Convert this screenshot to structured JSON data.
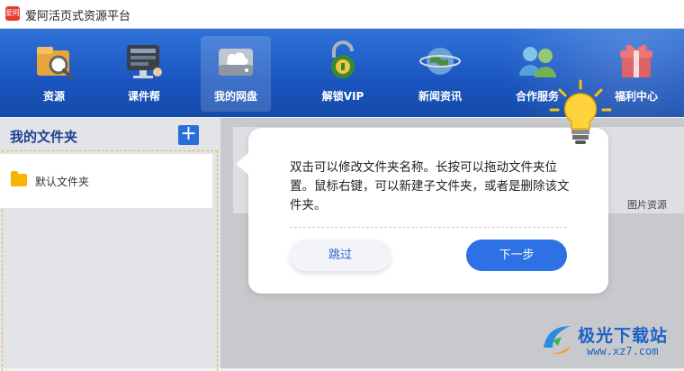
{
  "window": {
    "title": "爱阿活页式资源平台",
    "logo_text": "爱阿"
  },
  "toolbar": {
    "items": [
      {
        "label": "资源",
        "icon": "resource-magnifier-icon"
      },
      {
        "label": "课件帮",
        "icon": "courseware-monitor-icon"
      },
      {
        "label": "我的网盘",
        "icon": "cloud-drive-icon",
        "active": true
      },
      {
        "label": "解锁VIP",
        "icon": "vip-unlock-icon"
      },
      {
        "label": "新闻资讯",
        "icon": "news-globe-icon"
      },
      {
        "label": "合作服务",
        "icon": "partners-icon"
      },
      {
        "label": "福利中心",
        "icon": "gift-icon"
      }
    ]
  },
  "sidebar": {
    "title": "我的文件夹",
    "add_label": "+",
    "folders": [
      {
        "label": "默认文件夹"
      }
    ]
  },
  "main": {
    "tab_label": "图片资源"
  },
  "guide": {
    "text": "双击可以修改文件夹名称。长按可以拖动文件夹位置。鼠标右键，可以新建子文件夹，或者是删除该文件夹。",
    "skip_label": "跳过",
    "next_label": "下一步"
  },
  "watermark": {
    "name": "极光下载站",
    "url": "www.xz7.com"
  },
  "colors": {
    "toolbar": "#1a55bf",
    "accent": "#2e71e5",
    "sidebar_title": "#1d3f8f",
    "folder": "#f7b500"
  }
}
